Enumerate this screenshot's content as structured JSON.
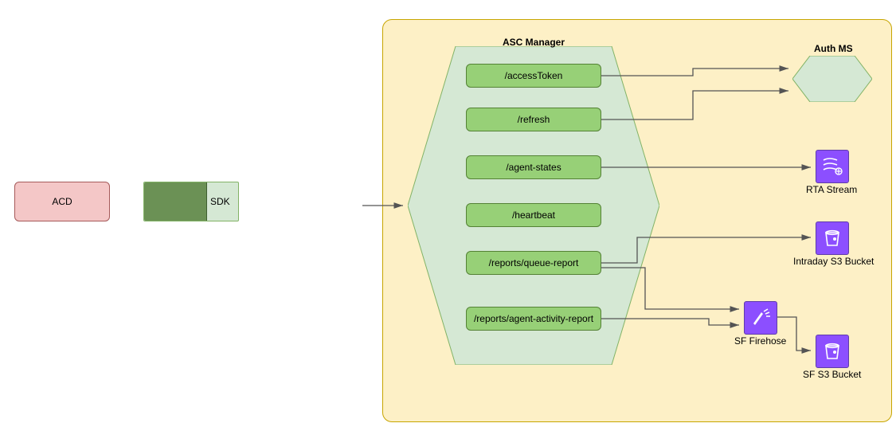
{
  "nodes": {
    "acd": "ACD",
    "sdk": "SDK",
    "asc_manager_title": "ASC Manager",
    "auth_ms_label": "Auth MS",
    "rta_stream_label": "RTA Stream",
    "intraday_bucket_label": "Intraday S3 Bucket",
    "sf_firehose_label": "SF Firehose",
    "sf_bucket_label": "SF S3 Bucket"
  },
  "endpoints": {
    "access_token": "/accessToken",
    "refresh": "/refresh",
    "agent_states": "/agent-states",
    "heartbeat": "/heartbeat",
    "queue_report": "/reports/queue-report",
    "agent_activity_report": "/reports/agent-activity-report"
  }
}
